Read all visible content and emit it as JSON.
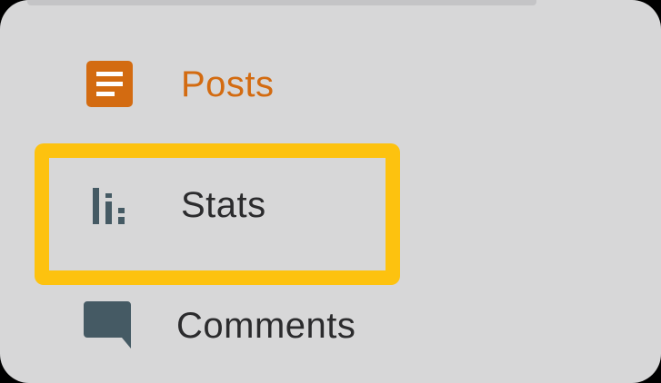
{
  "menu": {
    "items": [
      {
        "label": "Posts",
        "icon": "posts-icon",
        "selected": true
      },
      {
        "label": "Stats",
        "icon": "stats-icon",
        "selected": false
      },
      {
        "label": "Comments",
        "icon": "comments-icon",
        "selected": false
      }
    ]
  },
  "colors": {
    "accent": "#d36b11",
    "text": "#2b2b2d",
    "icon": "#455a64",
    "highlight": "#fdc20f",
    "background": "#d7d7d8"
  }
}
